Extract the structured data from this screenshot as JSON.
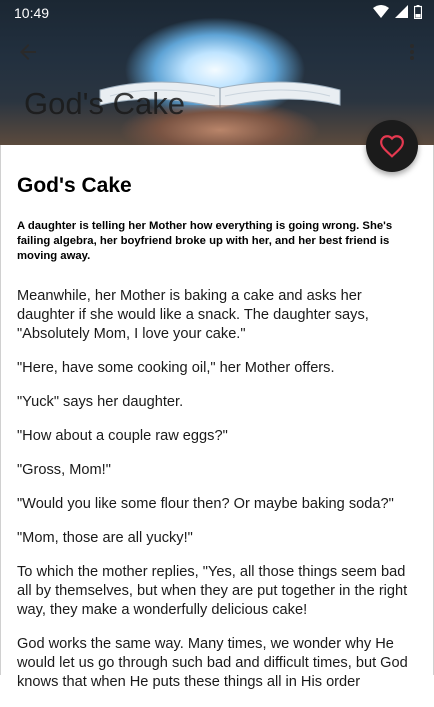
{
  "status_bar": {
    "time": "10:49"
  },
  "app_bar": {
    "title": "God's Cake"
  },
  "story": {
    "title": "God's Cake",
    "summary": "A daughter is telling her Mother how everything is going wrong. She's failing algebra, her boyfriend broke up with her, and her best friend is moving away.",
    "paragraphs": [
      "Meanwhile, her Mother is baking a cake and asks her daughter if she would like a snack. The daughter says, \"Absolutely Mom, I love your cake.\"",
      "\"Here, have some cooking oil,\" her Mother offers.",
      "\"Yuck\" says her daughter.",
      "\"How about a couple raw eggs?\"",
      "\"Gross, Mom!\"",
      "\"Would you like some flour then? Or maybe baking soda?\"",
      "\"Mom, those are all yucky!\"",
      "To which the mother replies, \"Yes, all those things seem bad all by themselves, but when they are put together in the right way, they make a wonderfully delicious cake!",
      "God works the same way. Many times, we wonder why He would let us go through such bad and difficult times, but God knows that when He puts these things all in His order"
    ]
  },
  "icons": {
    "back": "arrow-left-icon",
    "menu": "more-vert-icon",
    "favorite": "heart-outline-icon",
    "wifi": "wifi-icon",
    "signal": "signal-icon",
    "battery": "battery-icon"
  },
  "colors": {
    "accent": "#e53950",
    "fab_bg": "#1b1b1b"
  }
}
